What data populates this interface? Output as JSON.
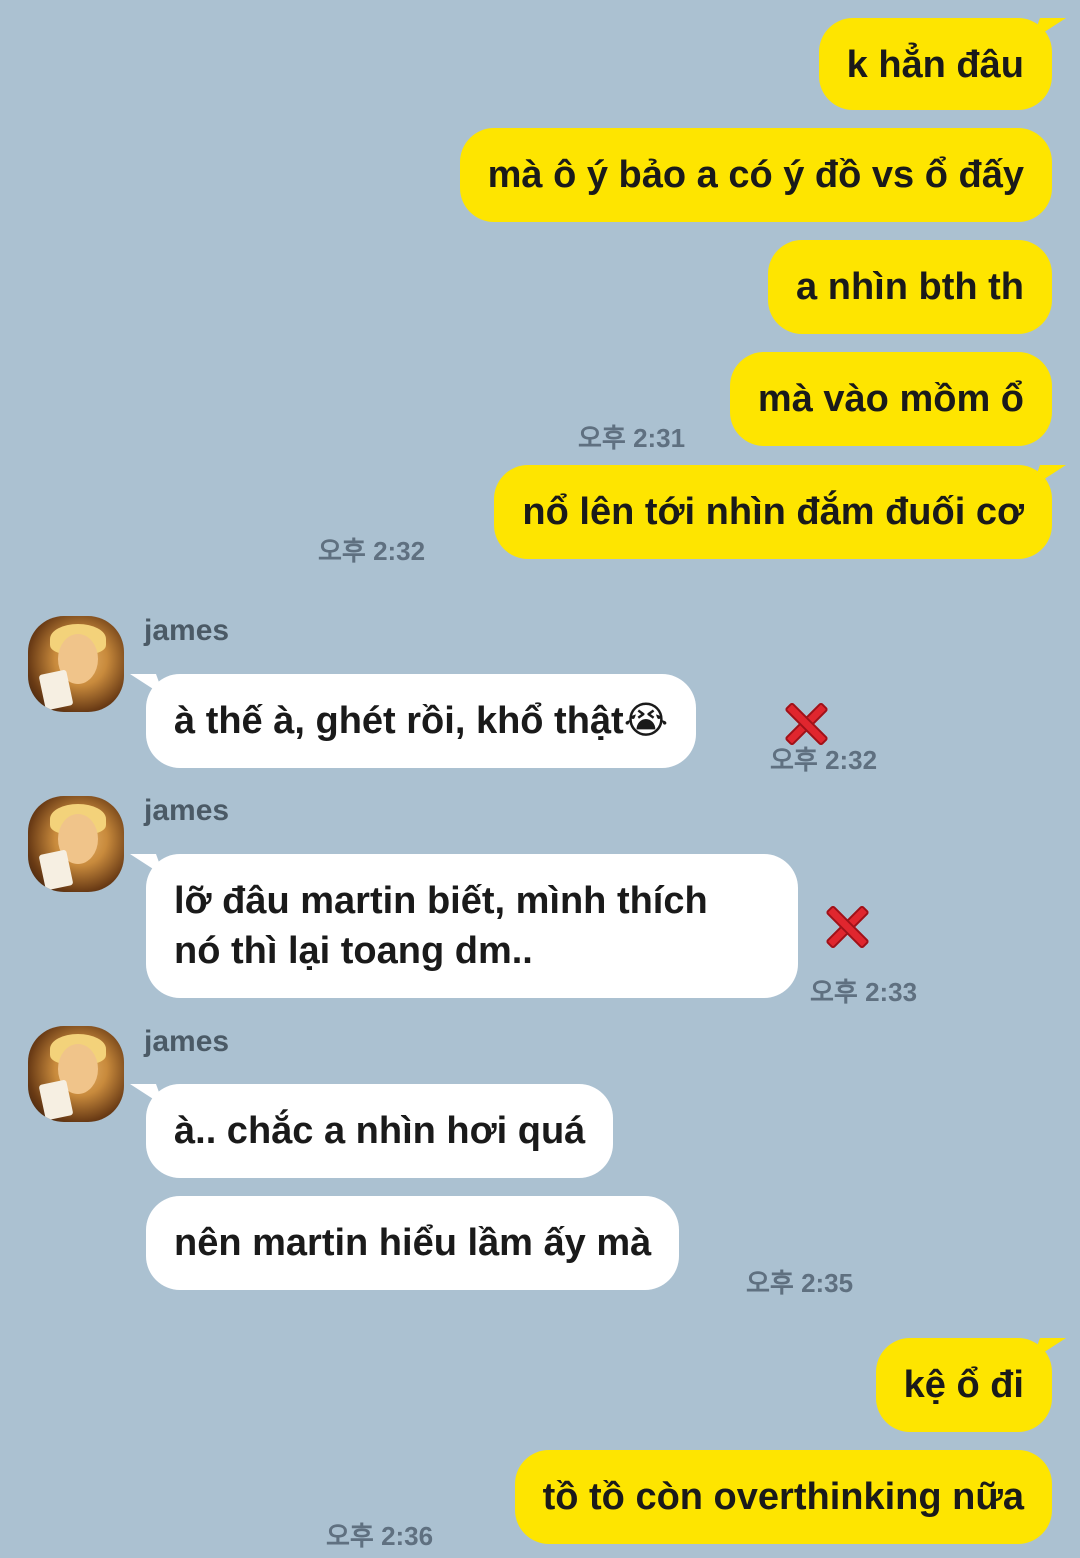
{
  "sender_name": "james",
  "messages_out_1": [
    {
      "text": "k hẳn đâu"
    },
    {
      "text": "mà ô ý bảo a có ý đồ vs ổ đấy"
    },
    {
      "text": "a nhìn bth th"
    },
    {
      "text": "mà vào mồm ổ",
      "time": "오후 2:31"
    },
    {
      "text": "nổ lên tới nhìn đắm đuối cơ",
      "time": "오후 2:32"
    }
  ],
  "messages_in": [
    {
      "text": "à thế à, ghét rồi, khổ thật😭",
      "time": "오후 2:32",
      "failed_icon": "red-x-icon"
    },
    {
      "lines": [
        "lỡ đâu martin biết, mình thích",
        "nó thì lại toang dm.."
      ],
      "time": "오후 2:33",
      "failed_icon": "red-x-icon"
    },
    {
      "text": "à.. chắc a nhìn hơi quá"
    },
    {
      "text": "nên martin hiểu lầm ấy mà",
      "time": "오후 2:35"
    }
  ],
  "messages_out_2": [
    {
      "text": "kệ ổ đi"
    },
    {
      "text": "tồ tồ còn overthinking nữa",
      "time": "오후 2:36"
    }
  ],
  "colors": {
    "background": "#abc1d1",
    "outgoing_bubble": "#fee500",
    "incoming_bubble": "#ffffff"
  }
}
